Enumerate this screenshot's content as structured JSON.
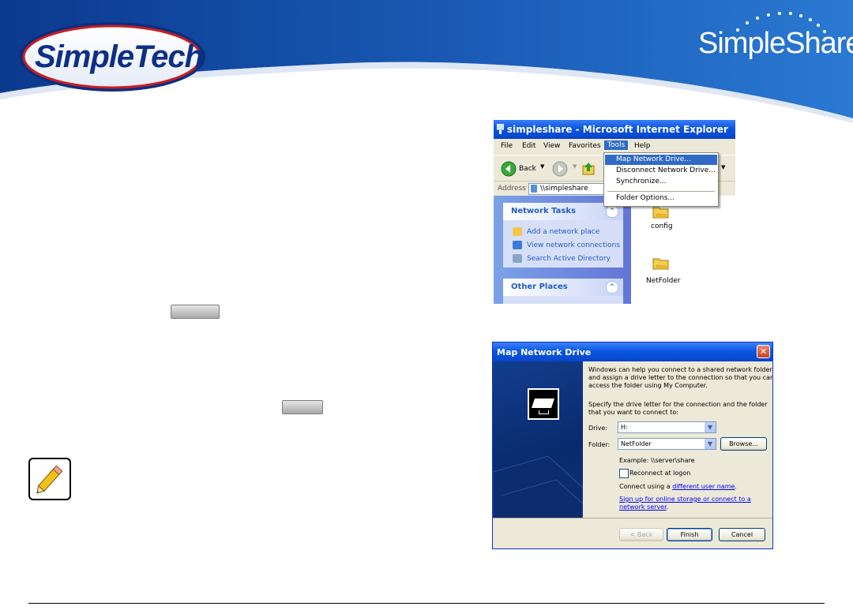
{
  "header": {
    "left_logo_text": "SimpleTech",
    "right_logo_text": "SimpleShare"
  },
  "ie_window": {
    "title": "simpleshare - Microsoft Internet Explorer",
    "menu": [
      "File",
      "Edit",
      "View",
      "Favorites",
      "Tools",
      "Help"
    ],
    "active_menu": "Tools",
    "back_label": "Back",
    "address_label": "Address",
    "address_value": "\\\\simpleshare",
    "tools_menu_items": [
      "Map Network Drive...",
      "Disconnect Network Drive...",
      "Synchronize...",
      "Folder Options..."
    ],
    "network_tasks_title": "Network Tasks",
    "network_tasks": [
      "Add a network place",
      "View network connections",
      "Search Active Directory"
    ],
    "other_places_title": "Other Places",
    "folders": [
      "config",
      "NetFolder"
    ]
  },
  "map_drive_dialog": {
    "title": "Map Network Drive",
    "intro_lines": [
      "Windows can help you connect to a shared network folder",
      "and assign a drive letter to the connection so that you can",
      "access the folder using My Computer."
    ],
    "specify_lines": [
      "Specify the drive letter for the connection and the folder",
      "that you want to connect to:"
    ],
    "drive_label": "Drive:",
    "drive_value": "H:",
    "folder_label": "Folder:",
    "folder_value": "NetFolder",
    "browse_label": "Browse...",
    "example_text": "Example: \\\\server\\share",
    "reconnect_label": "Reconnect at logon",
    "reconnect_checked": false,
    "connect_prefix": "Connect using a ",
    "connect_link": "different user name",
    "connect_suffix": ".",
    "signup_link_lines": [
      "Sign up for online storage or connect to a",
      "network server"
    ],
    "signup_suffix": ".",
    "back_button": "< Back",
    "finish_button": "Finish",
    "cancel_button": "Cancel"
  }
}
